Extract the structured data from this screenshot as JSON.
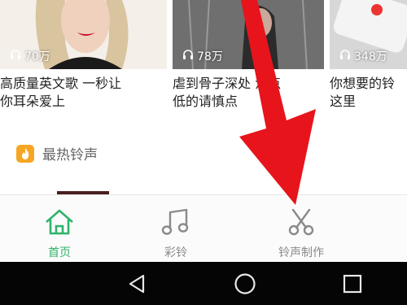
{
  "cards": [
    {
      "plays": "70万",
      "title_line1": "高质量英文歌 一秒让",
      "title_line2": "你耳朵爱上"
    },
    {
      "plays": "78万",
      "title_line1": "虐到骨子深处 泪点",
      "title_line2": "低的请慎点"
    },
    {
      "plays": "348万",
      "title_line1": "你想要的铃",
      "title_line2": "这里"
    }
  ],
  "section": {
    "title": "最热铃声",
    "icon": "flame-icon"
  },
  "tabs": [
    {
      "label": "首页",
      "icon": "home-icon",
      "active": true
    },
    {
      "label": "彩铃",
      "icon": "music-note-icon",
      "active": false
    },
    {
      "label": "铃声制作",
      "icon": "scissors-icon",
      "active": false
    }
  ],
  "system_nav": {
    "back": "back-icon",
    "home": "home-circle-icon",
    "recents": "recents-icon"
  },
  "colors": {
    "active_tab": "#2fb36b",
    "inactive_tab": "#8a8a8a",
    "arrow": "#e8141c"
  }
}
